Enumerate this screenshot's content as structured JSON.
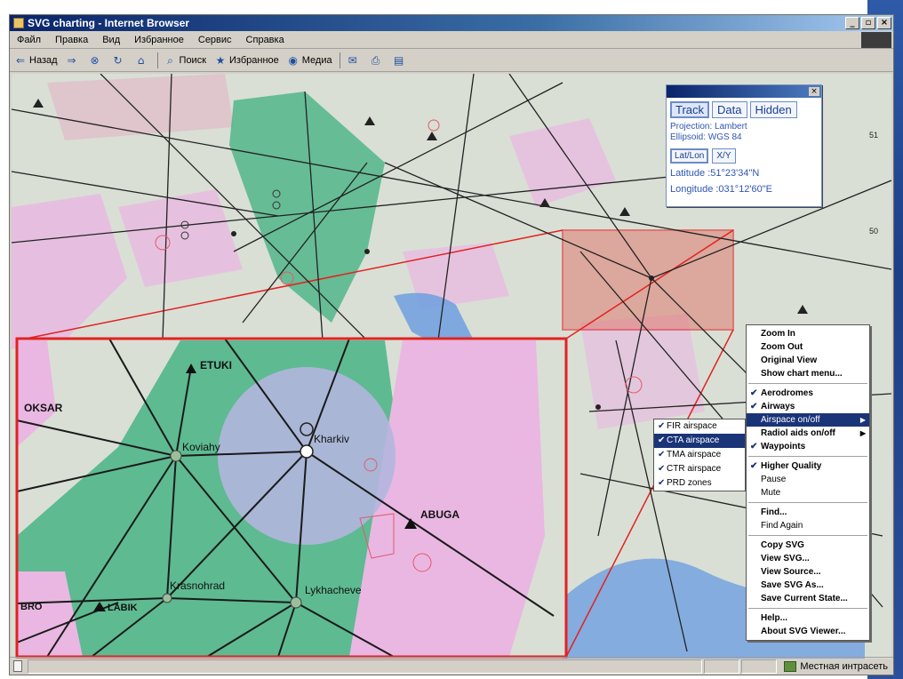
{
  "window": {
    "title": "SVG charting - Internet Browser",
    "controls": {
      "minimize": "_",
      "maximize": "▫",
      "close": "×"
    }
  },
  "menu": [
    "Файл",
    "Правка",
    "Вид",
    "Избранное",
    "Сервис",
    "Справка"
  ],
  "toolbar": {
    "back": "Назад",
    "search": "Поиск",
    "favorites": "Избранное",
    "media": "Медиа"
  },
  "map": {
    "colors": {
      "land": "#d9dfd5",
      "cta_airspace": "#3fb07f",
      "prd_zones": "#e9b7e2",
      "tma_circle": "#b3b6de",
      "water": "#6e9fe0",
      "inset_border": "#e32121",
      "airway": "#222222"
    },
    "labels": {
      "etuki": "ETUKI",
      "oksar": "OKSAR",
      "koviahy": "Koviahy",
      "kharkiv": "Kharkiv",
      "abuga": "ABUGA",
      "krasnohrad": "Krasnohrad",
      "lykhacheve": "Lykhacheve",
      "labik": "LABIK",
      "bro": "BRO"
    },
    "grid_labels": {
      "lat_51": "51",
      "lat_50": "50"
    }
  },
  "track_panel": {
    "tabs": [
      "Track",
      "Data",
      "Hidden"
    ],
    "projection": "Projection: Lambert",
    "ellipsoid": "Ellipsoid: WGS 84",
    "modes": [
      "Lat/Lon",
      "X/Y"
    ],
    "latitude": "Latitude :51°23'34\"N",
    "longitude": "Longitude :031°12'60\"E",
    "close": "×"
  },
  "submenu": [
    {
      "label": "FIR airspace",
      "checked": "✔"
    },
    {
      "label": "CTA airspace",
      "checked": "✔",
      "highlighted": true
    },
    {
      "label": "TMA airspace",
      "checked": "✔"
    },
    {
      "label": "CTR airspace",
      "checked": "✔"
    },
    {
      "label": "PRD zones",
      "checked": "✔"
    }
  ],
  "context_menu": {
    "zoom_in": "Zoom In",
    "zoom_out": "Zoom Out",
    "original_view": "Original View",
    "show_chart_menu": "Show chart menu...",
    "aerodromes": "Aerodromes",
    "airways": "Airways",
    "airspace": "Airspace on/off",
    "radio_aids": "Radiol aids on/off",
    "waypoints": "Waypoints",
    "higher_quality": "Higher Quality",
    "pause": "Pause",
    "mute": "Mute",
    "find": "Find...",
    "find_again": "Find Again",
    "copy_svg": "Copy SVG",
    "view_svg": "View SVG...",
    "view_source": "View Source...",
    "save_svg_as": "Save SVG As...",
    "save_current_state": "Save Current State...",
    "help": "Help...",
    "about": "About SVG Viewer...",
    "check": "✔",
    "arrow": "▶"
  },
  "status": {
    "zone": "Местная интрасеть"
  }
}
